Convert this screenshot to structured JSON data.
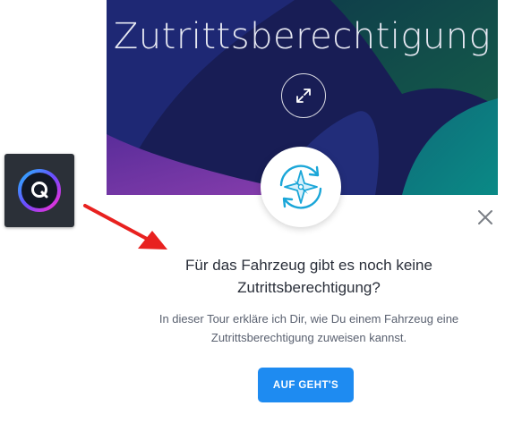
{
  "hero": {
    "title": "Zutrittsberechtigung",
    "expand_icon": "expand-arrows-icon"
  },
  "badge": {
    "icon": "compass-refresh-icon"
  },
  "launcher": {
    "icon": "q-logo-icon"
  },
  "pointer": {
    "color": "#e8211f"
  },
  "dialog": {
    "heading_line1": "Für das Fahrzeug gibt es noch keine",
    "heading_line2": "Zutrittsberechtigung?",
    "body_line1": "In dieser Tour erkläre ich Dir, wie Du einem Fahrzeug eine",
    "body_line2": "Zutrittsberechtigung zuweisen kannst.",
    "cta_label": "AUF GEHT'S",
    "close_icon": "close-icon"
  },
  "colors": {
    "accent": "#1e8bf1",
    "hero_bg": "#1a1f5c",
    "launcher_bg": "#2b3038"
  }
}
